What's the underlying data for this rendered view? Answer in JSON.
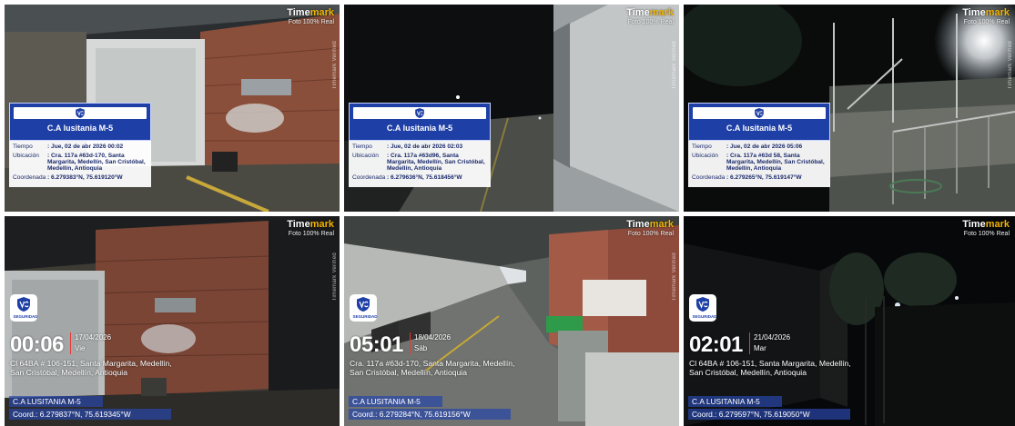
{
  "watermark": {
    "brand_main": "Time",
    "brand_accent": "mark",
    "subtitle": "Foto 100% Real",
    "side_label": "Timemark Verified"
  },
  "colors": {
    "card_header": "#1e3fa6",
    "card_text": "#1b2a6b",
    "accent_yellow": "#f4b400",
    "date_divider": "#e53935"
  },
  "top_cards": [
    {
      "title": "C.A lusitania M-5",
      "time_label": "Tiempo",
      "time_value": ": Jue, 02 de abr 2026 00:02",
      "location_label": "Ubicación",
      "location_value": ": Cra. 117a #63d-170, Santa Margarita, Medellín, San Cristóbal, Medellín, Antioquia",
      "coord_label": "Coordenada",
      "coord_value": ": 6.279383°N, 75.619120°W"
    },
    {
      "title": "C.A lusitania M-5",
      "time_label": "Tiempo",
      "time_value": ": Jue, 02 de abr 2026 02:03",
      "location_label": "Ubicación",
      "location_value": ": Cra. 117a #63d96, Santa Margarita, Medellín, San Cristóbal, Medellín, Antioquia",
      "coord_label": "Coordenada",
      "coord_value": ": 6.279636°N, 75.618456°W"
    },
    {
      "title": "C.A lusitania M-5",
      "time_label": "Tiempo",
      "time_value": ": Jue, 02 de abr 2026 05:06",
      "location_label": "Ubicación",
      "location_value": ": Cra. 117a #63d 58, Santa Margarita, Medellín, San Cristóbal, Medellín, Antioquia",
      "coord_label": "Coordenada",
      "coord_value": ": 6.279265°N, 75.619147°W"
    }
  ],
  "security_logo_text": "SEGURIDAD",
  "bottom_cards": [
    {
      "clock": "00:06",
      "date": "17/04/2026",
      "weekday": "Vie",
      "address": "Cl 64BA # 106-151, Santa Margarita, Medellín, San Cristóbal, Medellín, Antioquia",
      "site": "C.A LUSITANIA M-5",
      "coord": "Coord.: 6.279837°N, 75.619345°W"
    },
    {
      "clock": "05:01",
      "date": "18/04/2026",
      "weekday": "Sáb",
      "address": "Cra. 117a #63d-170, Santa Margarita, Medellín, San Cristóbal, Medellín, Antioquia",
      "site": "C.A LUSITANIA M-5",
      "coord": "Coord.: 6.279284°N, 75.619156°W"
    },
    {
      "clock": "02:01",
      "date": "21/04/2026",
      "weekday": "Mar",
      "address": "Cl 64BA # 106-151, Santa Margarita, Medellín, San Cristóbal, Medellín, Antioquia",
      "site": "C.A LUSITANIA M-5",
      "coord": "Coord.: 6.279597°N, 75.619050°W"
    }
  ]
}
